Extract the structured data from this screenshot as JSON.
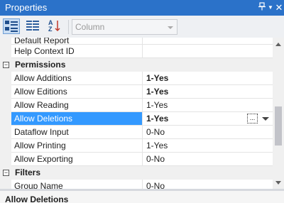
{
  "window": {
    "title": "Properties",
    "pin_glyph": "📌",
    "menu_glyph": "▼",
    "close_glyph": "✕"
  },
  "toolbar": {
    "categorized_icon": "categorized-icon",
    "alphabetical_icon": "property-pages-icon",
    "sort_icon": "sort-az-icon",
    "combo_value": "Column"
  },
  "rows": [
    {
      "type": "prop",
      "name": "Default Report",
      "value": ""
    },
    {
      "type": "prop",
      "name": "Help Context ID",
      "value": ""
    },
    {
      "type": "category",
      "label": "Permissions",
      "expander": "⊟"
    },
    {
      "type": "prop",
      "name": "Allow Additions",
      "value": "1-Yes"
    },
    {
      "type": "prop",
      "name": "Allow Editions",
      "value": "1-Yes"
    },
    {
      "type": "prop",
      "name": "Allow Reading",
      "value": "1-Yes"
    },
    {
      "type": "prop",
      "name": "Allow Deletions",
      "value": "1-Yes"
    },
    {
      "type": "prop",
      "name": "Dataflow Input",
      "value": "0-No"
    },
    {
      "type": "prop",
      "name": "Allow Printing",
      "value": "1-Yes"
    },
    {
      "type": "prop",
      "name": "Allow Exporting",
      "value": "0-No"
    },
    {
      "type": "category",
      "label": "Filters",
      "expander": "⊟"
    },
    {
      "type": "prop",
      "name": "Group Name",
      "value": "0-No"
    }
  ],
  "selected_row": {
    "ellipsis_label": "..."
  },
  "description": {
    "title": "Allow Deletions"
  },
  "colors": {
    "titlebar": "#2b72c9",
    "selection": "#3399ff"
  }
}
